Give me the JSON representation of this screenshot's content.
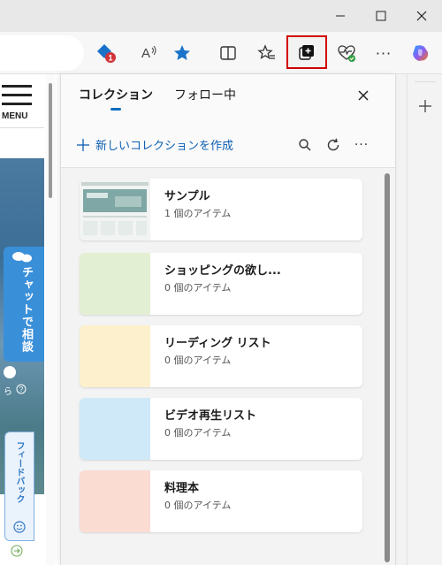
{
  "window": {
    "minimize": "—",
    "maximize": "☐",
    "close": "✕"
  },
  "toolbar": {
    "tracking_badge": "1",
    "read_aloud": "A",
    "more": "···"
  },
  "webpage": {
    "menu_label": "MENU",
    "chat_label": "チャットで相談",
    "feedback_label": "フィードバック",
    "ra_text": "ら"
  },
  "panel": {
    "tab_collections": "コレクション",
    "tab_following": "フォロー中",
    "new_collection": "新しいコレクションを作成",
    "more": "···",
    "collections": [
      {
        "title": "サンプル",
        "subtitle": "1 個のアイテム",
        "color": "#dfe7e4"
      },
      {
        "title": "ショッピングの欲し...",
        "subtitle": "0 個のアイテム",
        "color": "#e3efd3"
      },
      {
        "title": "リーディング リスト",
        "subtitle": "0 個のアイテム",
        "color": "#fdf0cc"
      },
      {
        "title": "ビデオ再生リスト",
        "subtitle": "0 個のアイテム",
        "color": "#cfe9f8"
      },
      {
        "title": "料理本",
        "subtitle": "0 個のアイテム",
        "color": "#fbdcd3"
      }
    ]
  },
  "colors": {
    "accent": "#0f6cbd",
    "highlight_border": "#d10000"
  }
}
